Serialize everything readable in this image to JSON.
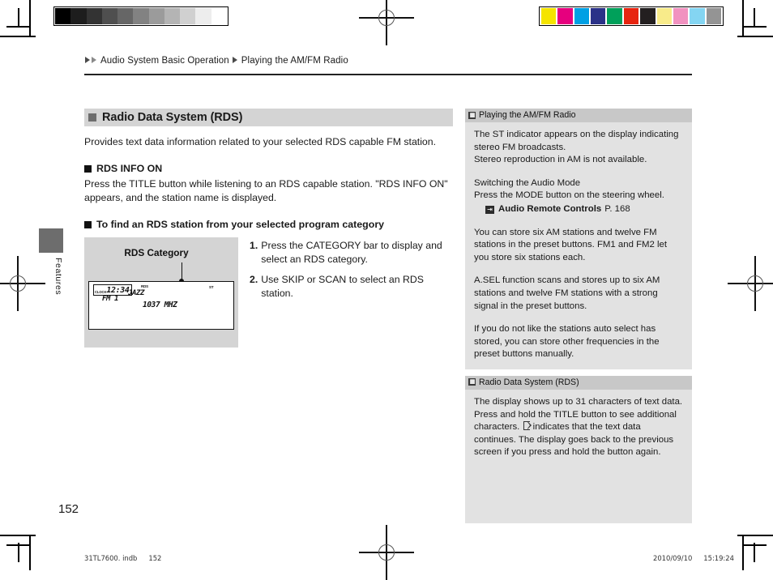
{
  "document": {
    "page_number": "152",
    "side_tab_label": "Features",
    "footer_filename": "31TL7600. indb",
    "footer_page": "152",
    "footer_date": "2010/09/10",
    "footer_time": "15:19:24"
  },
  "breadcrumb": {
    "level1": "Audio System Basic Operation",
    "level2": "Playing the AM/FM Radio"
  },
  "main": {
    "section_title": "Radio Data System (RDS)",
    "intro": "Provides text data information related to your selected RDS capable FM station.",
    "sub_head_1": "RDS INFO ON",
    "sub_body_1": "Press the TITLE button while listening to an RDS capable station.  \"RDS INFO ON\" appears, and the station name is displayed.",
    "sub_head_2": "To find an RDS station from your selected program category",
    "illustration": {
      "caption": "RDS Category",
      "lcd": {
        "clock_label": "CLOCK",
        "clock_value": "12:34",
        "band": "FM 1",
        "rds_indicator": "RDS",
        "stereo_indicator": "ST",
        "category": "JAZZ",
        "frequency": "1037 MHZ"
      }
    },
    "steps": [
      {
        "num": "1.",
        "text": "Press the CATEGORY bar to display and select an RDS category."
      },
      {
        "num": "2.",
        "text": "Use SKIP or SCAN to select an RDS station."
      }
    ]
  },
  "notes": [
    {
      "title": "Playing the AM/FM Radio",
      "glyph": "note-icon",
      "paragraphs": [
        "The ST indicator appears on the display indicating stereo FM broadcasts.\nStereo reproduction in AM is not available.",
        "Switching the Audio Mode\nPress the MODE button on the steering wheel."
      ],
      "link": {
        "icon": "page-link-icon",
        "text": "Audio Remote Controls",
        "page": "P. 168"
      },
      "paragraphs_after": [
        "You can store six AM stations and twelve FM stations in the preset buttons. FM1 and FM2 let you store six stations each.",
        "A.SEL function scans and stores up to six AM stations and twelve FM stations with a strong signal in the preset buttons.",
        "If you do not like the stations auto select has stored, you can store other frequencies in the preset buttons manually."
      ]
    },
    {
      "title": "Radio Data System (RDS)",
      "glyph": "note-icon",
      "paragraphs": [
        "The display shows up to 31 characters of text data. Press and hold the TITLE button to see additional characters."
      ],
      "paragraph_with_triangle_pre": "characters. ",
      "paragraph_with_triangle_post": " indicates that the text data continues. The display goes back to the previous screen if you press and hold the button again.",
      "body_line1": "The display shows up to 31 characters of text data.",
      "body_line2": "Press and hold the TITLE button to see additional"
    }
  ],
  "print_marks": {
    "gray_strip": [
      "#000000",
      "#1d1d1d",
      "#333333",
      "#4f4f4f",
      "#666666",
      "#828282",
      "#9b9b9b",
      "#b4b4b4",
      "#d0d0d0",
      "#ededed",
      "#ffffff"
    ],
    "color_strip": [
      "#f5e400",
      "#e6007e",
      "#00a0e4",
      "#2b3288",
      "#00a05a",
      "#e72410",
      "#231f20",
      "#f8eb8a",
      "#f192c0",
      "#84d5f2",
      "#949494"
    ]
  }
}
